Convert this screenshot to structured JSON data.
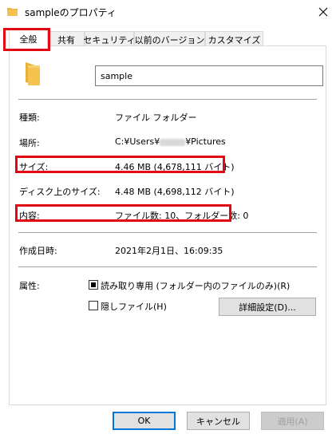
{
  "window": {
    "title": "sampleのプロパティ"
  },
  "tabs": [
    {
      "label": "全般"
    },
    {
      "label": "共有"
    },
    {
      "label": "セキュリティ"
    },
    {
      "label": "以前のバージョン"
    },
    {
      "label": "カスタマイズ"
    }
  ],
  "name_field": {
    "value": "sample"
  },
  "properties": {
    "type": {
      "label": "種類:",
      "value": "ファイル フォルダー"
    },
    "location": {
      "label": "場所:",
      "prefix": "C:¥Users¥",
      "suffix": "¥Pictures"
    },
    "size": {
      "label": "サイズ:",
      "value": "4.46 MB (4,678,111 バイト)"
    },
    "size_on_disk": {
      "label": "ディスク上のサイズ:",
      "value": "4.48 MB (4,698,112 バイト)"
    },
    "contents": {
      "label": "内容:",
      "value": "ファイル数: 10、フォルダー数: 0"
    },
    "created": {
      "label": "作成日時:",
      "value": "2021年2月1日、16:09:35"
    }
  },
  "attributes": {
    "label": "属性:",
    "readonly": {
      "label": "読み取り専用 (フォルダー内のファイルのみ)(R)"
    },
    "hidden": {
      "label": "隠しファイル(H)"
    },
    "advanced_label": "詳細設定(D)..."
  },
  "buttons": {
    "ok": "OK",
    "cancel": "キャンセル",
    "apply": "適用(A)"
  },
  "colors": {
    "highlight": "#e30613",
    "folder": "#f4c24d",
    "default_button": "#0078d7"
  }
}
